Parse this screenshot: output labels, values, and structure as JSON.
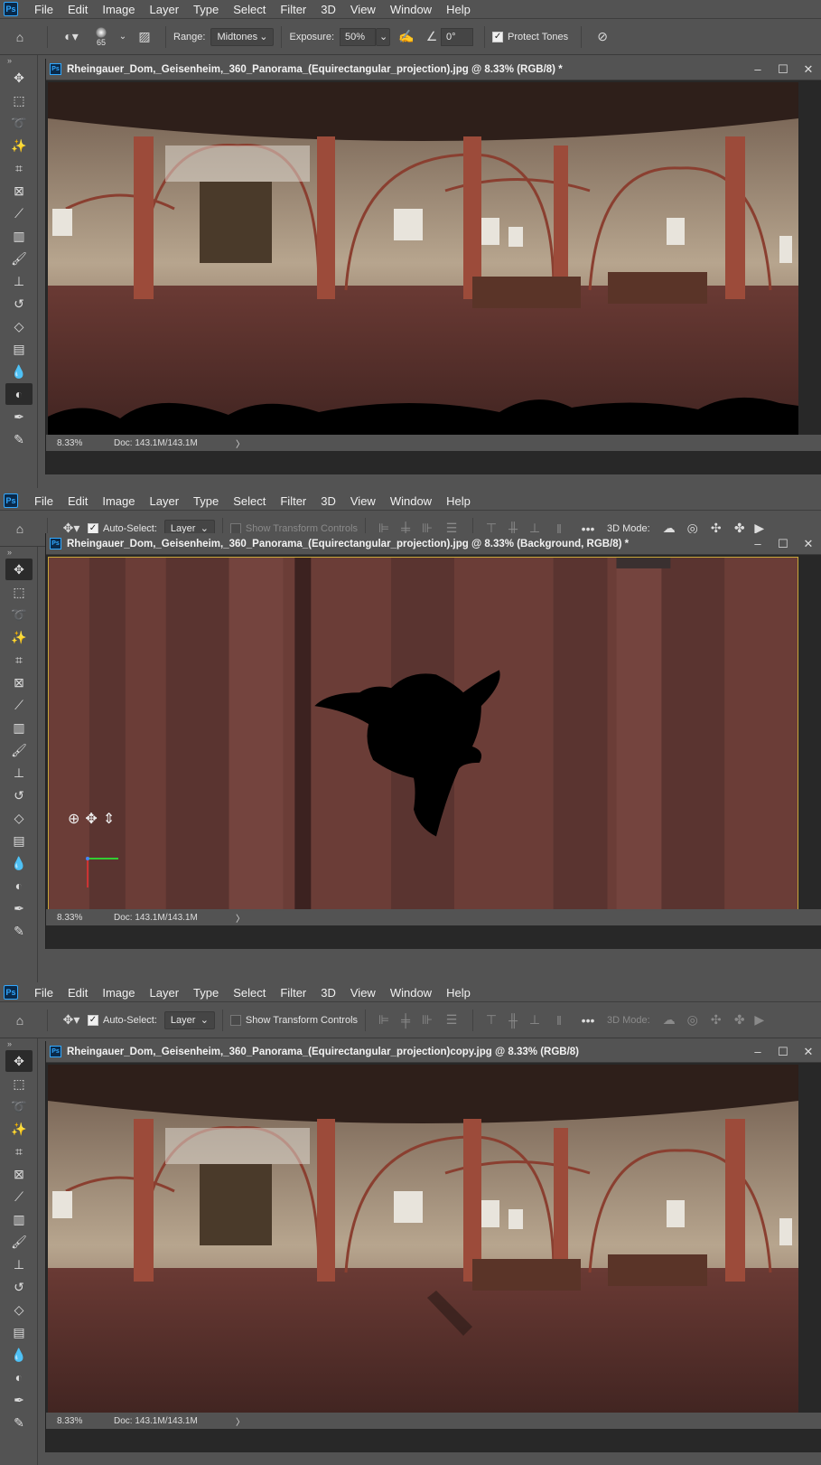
{
  "menu": [
    "File",
    "Edit",
    "Image",
    "Layer",
    "Type",
    "Select",
    "Filter",
    "3D",
    "View",
    "Window",
    "Help"
  ],
  "ps_logo": "Ps",
  "sponge_options": {
    "brush_size": "65",
    "range_label": "Range:",
    "range_value": "Midtones",
    "exposure_label": "Exposure:",
    "exposure_value": "50%",
    "angle_value": "0°",
    "protect_tones_label": "Protect Tones"
  },
  "move_options": {
    "auto_select_label": "Auto-Select:",
    "auto_select_value": "Layer",
    "show_transform_label": "Show Transform Controls",
    "more": "•••",
    "mode_3d_label": "3D Mode:"
  },
  "docs": [
    {
      "title": "Rheingauer_Dom,_Geisenheim,_360_Panorama_(Equirectangular_projection).jpg @ 8.33% (RGB/8) *",
      "zoom": "8.33%",
      "doc_size": "Doc: 143.1M/143.1M"
    },
    {
      "title": "Rheingauer_Dom,_Geisenheim,_360_Panorama_(Equirectangular_projection).jpg @ 8.33% (Background, RGB/8) *",
      "zoom": "8.33%",
      "doc_size": "Doc: 143.1M/143.1M"
    },
    {
      "title": "Rheingauer_Dom,_Geisenheim,_360_Panorama_(Equirectangular_projection)copy.jpg @ 8.33% (RGB/8)",
      "zoom": "8.33%",
      "doc_size": "Doc: 143.1M/143.1M"
    }
  ],
  "status_arrow": "〉",
  "colors": {
    "accent": "#31a8ff",
    "active_border": "#c8a73a",
    "ui_gray": "#535353"
  }
}
